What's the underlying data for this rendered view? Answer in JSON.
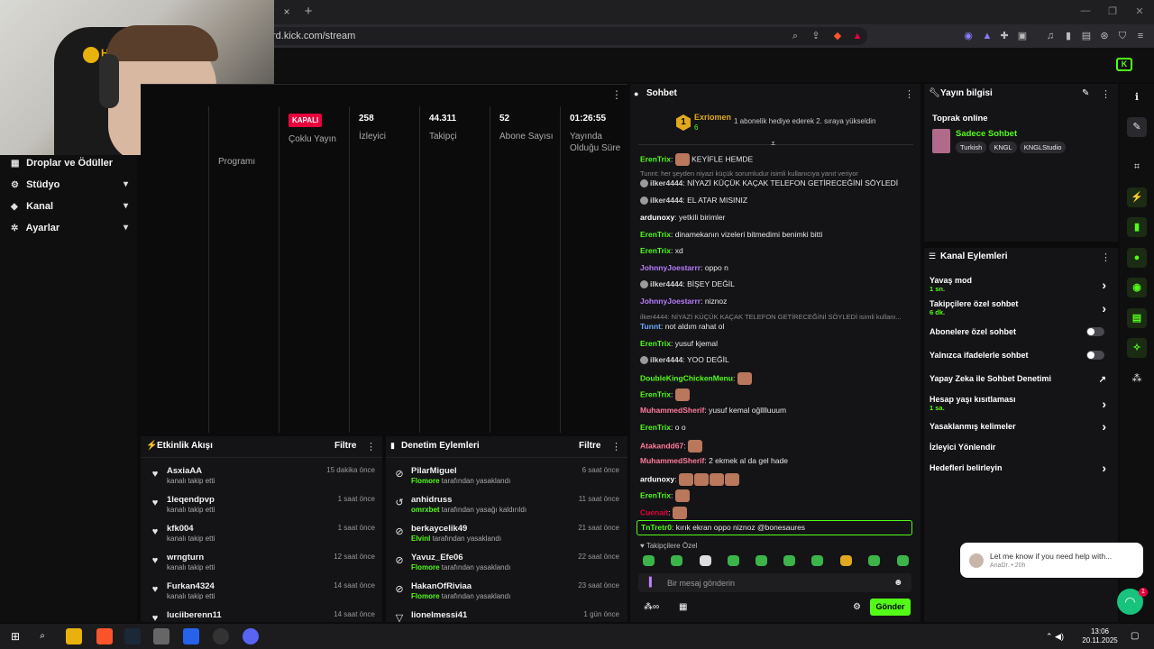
{
  "browser": {
    "url": "rd.kick.com/stream",
    "tab_close": "×",
    "tab_new": "+"
  },
  "webcam": {
    "chair_brand": "HAV"
  },
  "leftnav": {
    "items": [
      {
        "label": "Droplar ve Ödüller"
      },
      {
        "label": "Stüdyo"
      },
      {
        "label": "Kanal"
      },
      {
        "label": "Ayarlar"
      }
    ],
    "partial_label": "Programı"
  },
  "stats": {
    "status_badge": "KAPALI",
    "multi_stream_label": "Çoklu Yayın",
    "viewers_value": "258",
    "viewers_label": "İzleyici",
    "followers_value": "44.311",
    "followers_label": "Takipçi",
    "subs_value": "52",
    "subs_label": "Abone Sayısı",
    "duration_value": "01:26:55",
    "duration_label": "Yayında Olduğu Süre"
  },
  "activity": {
    "title": "Etkinlik Akışı",
    "filter": "Filtre",
    "rows": [
      {
        "name": "AsxiaAA",
        "sub": "kanalı takip etti",
        "time": "15 dakika önce"
      },
      {
        "name": "1leqendpvp",
        "sub": "kanalı takip etti",
        "time": "1 saat önce"
      },
      {
        "name": "kfk004",
        "sub": "kanalı takip etti",
        "time": "1 saat önce"
      },
      {
        "name": "wrngturn",
        "sub": "kanalı takip etti",
        "time": "12 saat önce"
      },
      {
        "name": "Furkan4324",
        "sub": "kanalı takip etti",
        "time": "14 saat önce"
      },
      {
        "name": "luciiberenn11",
        "sub": "",
        "time": "14 saat önce"
      }
    ]
  },
  "moderation": {
    "title": "Denetim Eylemleri",
    "filter": "Filtre",
    "rows": [
      {
        "name": "PilarMiguel",
        "actor": "Flomore",
        "action": "tarafından yasaklandı",
        "time": "6 saat önce"
      },
      {
        "name": "anhidruss",
        "actor": "omrxbet",
        "action": "tarafından yasağı kaldırıldı",
        "time": "11 saat önce"
      },
      {
        "name": "berkaycelik49",
        "actor": "Elvinl",
        "action": "tarafından yasaklandı",
        "time": "21 saat önce"
      },
      {
        "name": "Yavuz_Efe06",
        "actor": "Flomore",
        "action": "tarafından yasaklandı",
        "time": "22 saat önce"
      },
      {
        "name": "HakanOfRiviaa",
        "actor": "Flomore",
        "action": "tarafından yasaklandı",
        "time": "23 saat önce"
      },
      {
        "name": "lionelmessi41",
        "actor": "",
        "action": "",
        "time": "1 gün önce"
      }
    ]
  },
  "chat": {
    "title": "Sohbet",
    "leader_rank": "1",
    "leader_name": "Exriomen",
    "leader_count": "6",
    "leader_msg": "1 abonelik hediye ederek 2. sıraya yükseldin",
    "lines": [
      {
        "user": "ErenTrix",
        "color": "#53fc18",
        "text": "KEYİFLE HEMDE",
        "emote": true
      },
      {
        "reply": "Tunnt: her şeyden niyazi küçük sorumludur isimli kullanıcıya yanıt veriyor"
      },
      {
        "user": "ilker4444",
        "color": "#cfcfcf",
        "badge": true,
        "text": "NİYAZİ KÜÇÜK KAÇAK TELEFON GETİRECEĞİNİ SÖYLEDİ"
      },
      {
        "user": "ilker4444",
        "color": "#cfcfcf",
        "badge": true,
        "text": "EL ATAR MISINIZ"
      },
      {
        "user": "ardunoxy",
        "color": "#ffffff",
        "text": "yetkili birimler"
      },
      {
        "user": "ErenTrix",
        "color": "#53fc18",
        "text": "dinamekanın vizeleri bitmedimi benimki bitti"
      },
      {
        "user": "ErenTrix",
        "color": "#53fc18",
        "text": "xd"
      },
      {
        "user": "JohnnyJoestarrr",
        "color": "#b87cff",
        "text": "oppo n"
      },
      {
        "user": "ilker4444",
        "color": "#cfcfcf",
        "badge": true,
        "text": "BİŞEY DEĞİL"
      },
      {
        "user": "JohnnyJoestarrr",
        "color": "#b87cff",
        "text": "niznoz"
      },
      {
        "reply": "ilker4444: NİYAZİ KÜÇÜK KAÇAK TELEFON GETİRECEĞİNİ SÖYLEDİ isimli kullanı..."
      },
      {
        "user": "Tunnt",
        "color": "#6ea8ff",
        "text": "not aldım rahat ol"
      },
      {
        "user": "ErenTrix",
        "color": "#53fc18",
        "text": "yusuf kjemal"
      },
      {
        "user": "ilker4444",
        "color": "#cfcfcf",
        "badge": true,
        "text": "YOO DEĞİL"
      },
      {
        "user": "DoubleKingChickenMenu",
        "color": "#53fc18",
        "text": "",
        "emote": true
      },
      {
        "user": "ErenTrix",
        "color": "#53fc18",
        "text": "",
        "emote": true
      },
      {
        "user": "MuhammedSherif",
        "color": "#ff7a9c",
        "text": "yusuf kemal oğlllluuum"
      },
      {
        "user": "ErenTrix",
        "color": "#53fc18",
        "text": "o o"
      },
      {
        "user": "Atakandd67",
        "color": "#ff7a9c",
        "text": "",
        "emote": true
      },
      {
        "user": "MuhammedSherif",
        "color": "#ff7a9c",
        "text": "2 ekmek al da gel hade"
      },
      {
        "user": "ardunoxy",
        "color": "#ffffff",
        "text": "",
        "emote4": true
      },
      {
        "user": "ErenTrix",
        "color": "#53fc18",
        "text": "",
        "emote": true
      },
      {
        "user": "Cuenait",
        "color": "#e8003d",
        "text": "",
        "emote": true
      }
    ],
    "highlight_user": "TnTretr0",
    "highlight_text": "kırık ekran oppo niznoz @bonesaures",
    "followers_only": "Takipçilere Özel",
    "input_placeholder": "Bir mesaj gönderin",
    "send": "Gönder"
  },
  "info": {
    "title": "Yayın bilgisi",
    "stream_title": "Toprak online",
    "category": "Sadece Sohbet",
    "tags": [
      "Turkish",
      "KNGL",
      "KNGLStudio"
    ]
  },
  "actions": {
    "title": "Kanal Eylemleri",
    "items": [
      {
        "label": "Yavaş mod",
        "sub": "1 sn.",
        "kind": "chev"
      },
      {
        "label": "Takipçilere özel sohbet",
        "sub": "6 dk.",
        "kind": "chev"
      },
      {
        "label": "Abonelere özel sohbet",
        "sub": "",
        "kind": "toggle"
      },
      {
        "label": "Yalnızca ifadelerle sohbet",
        "sub": "",
        "kind": "toggle"
      },
      {
        "label": "Yapay Zeka ile Sohbet Denetimi",
        "sub": "",
        "kind": "ext"
      },
      {
        "label": "Hesap yaşı kısıtlaması",
        "sub": "1 sa.",
        "kind": "chev"
      },
      {
        "label": "Yasaklanmış kelimeler",
        "sub": "",
        "kind": "chev"
      },
      {
        "label": "İzleyici Yönlendir",
        "sub": "",
        "kind": "none"
      },
      {
        "label": "Hedefleri belirleyin",
        "sub": "",
        "kind": "chev"
      }
    ]
  },
  "toast": {
    "message": "Let me know if you need help with...",
    "sub": "AnaDr. • 20h",
    "badge": "1"
  },
  "taskbar": {
    "time": "13:06",
    "date": "20.11.2025"
  }
}
